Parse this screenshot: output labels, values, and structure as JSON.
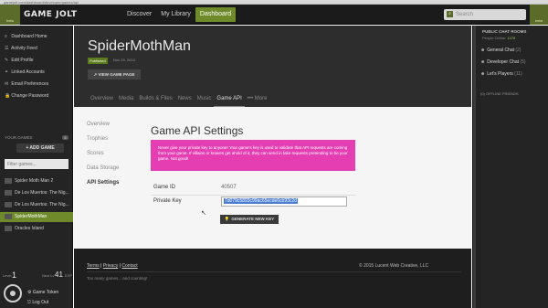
{
  "browser": {
    "url": "gamejolt.com/dashboard/developer/games/api"
  },
  "topbar": {
    "logo_tag": "beta",
    "logo_text": "GAME JOLT",
    "nav": [
      "Discover",
      "My Library",
      "Dashboard"
    ],
    "active_nav": "Dashboard",
    "search_placeholder": "Search",
    "user_tag": "beta"
  },
  "sidebar": {
    "items": [
      {
        "icon": "≡",
        "label": "Dashboard Home"
      },
      {
        "icon": "☰",
        "label": "Activity Feed"
      },
      {
        "icon": "✎",
        "label": "Edit Profile"
      },
      {
        "icon": "⚭",
        "label": "Linked Accounts"
      },
      {
        "icon": "✉",
        "label": "Email Preferences"
      },
      {
        "icon": "🔒",
        "label": "Change Password"
      }
    ],
    "games_heading": "YOUR GAMES",
    "games_count": "6",
    "add_game_label": "+ ADD GAME",
    "filter_placeholder": "Filter games...",
    "games": [
      "Spider Moth Man 2",
      "De Los Muertos: The Nig...",
      "De Los Muertos: The Nig...",
      "SpiderMothMan",
      "Oracles Island"
    ],
    "active_game": "SpiderMothMan",
    "level_label": "Level",
    "level_value": "1",
    "next_label": "Next Lv",
    "xp_value": "41",
    "xp_unit": "EXP",
    "bottom_items": [
      "Game Token",
      "Log Out"
    ]
  },
  "header": {
    "title": "SpiderMothMan",
    "status": "Published",
    "date": "Nov 29, 2014",
    "view_button": "VIEW GAME PAGE",
    "tabs": [
      "Overview",
      "Media",
      "Builds & Files",
      "News",
      "Music",
      "Game API",
      "More"
    ],
    "active_tab": "Game API",
    "more_prefix": "•••"
  },
  "content": {
    "subnav": [
      "Overview",
      "Trophies",
      "Scores",
      "Data Storage",
      "API Settings"
    ],
    "active_subnav": "API Settings",
    "title": "Game API Settings",
    "warning": "Never give your private key to anyone! Your game's key is used to validate that API requests are coming from your game. If villains or knaves get ahold of it, they can send in fake requests pretending to be your game. Not good!",
    "game_id_label": "Game ID",
    "game_id_value": "40507",
    "private_key_label": "Private Key",
    "private_key_value": "7d079c5893c99ac65ecde6cb93c2d",
    "generate_button": "GENERATE NEW KEY"
  },
  "footer": {
    "links": [
      "Terms",
      "Privacy",
      "Contact"
    ],
    "separator": "|",
    "copyright": "© 2015 Lucent Web Creative, LLC",
    "tagline": "Too many games... and counting!"
  },
  "rightpanel": {
    "heading": "PUBLIC CHAT ROOMS",
    "people_online_label": "People Online:",
    "people_online_value": "1078",
    "rooms": [
      {
        "name": "General Chat",
        "count": "(2)"
      },
      {
        "name": "Developer Chat",
        "count": "(5)"
      },
      {
        "name": "Let's Players",
        "count": "(11)"
      }
    ],
    "offline_label": "(0) OFFLINE FRIENDS"
  }
}
